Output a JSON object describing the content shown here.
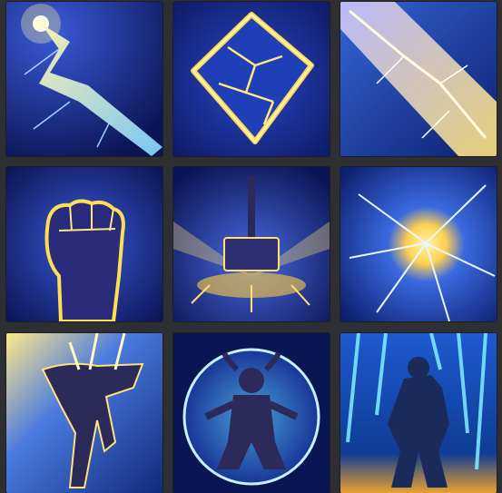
{
  "grid": {
    "background": "#2e2f33",
    "tiles": [
      {
        "icon": "lightning-bolt-icon",
        "base": "#14257a",
        "glow": "#ffe36b"
      },
      {
        "icon": "cracked-crystal-shield-icon",
        "base": "#0e1e6e",
        "glow": "#ffd84a"
      },
      {
        "icon": "lightning-beam-icon",
        "base": "#1b3a9c",
        "glow": "#fff0a0"
      },
      {
        "icon": "lightning-fist-icon",
        "base": "#16206a",
        "glow": "#ffdd55"
      },
      {
        "icon": "hammer-strike-icon",
        "base": "#18247a",
        "glow": "#ffe070"
      },
      {
        "icon": "lightning-burst-icon",
        "base": "#1a3aa0",
        "glow": "#fff3a8"
      },
      {
        "icon": "struck-hero-icon",
        "base": "#1c3fa2",
        "glow": "#ffe98a"
      },
      {
        "icon": "lightning-sphere-minotaur-icon",
        "base": "#12256e",
        "glow": "#c8f0ff"
      },
      {
        "icon": "lightning-storm-warrior-icon",
        "base": "#0f3c94",
        "glow": "#7ff0ff"
      }
    ]
  }
}
